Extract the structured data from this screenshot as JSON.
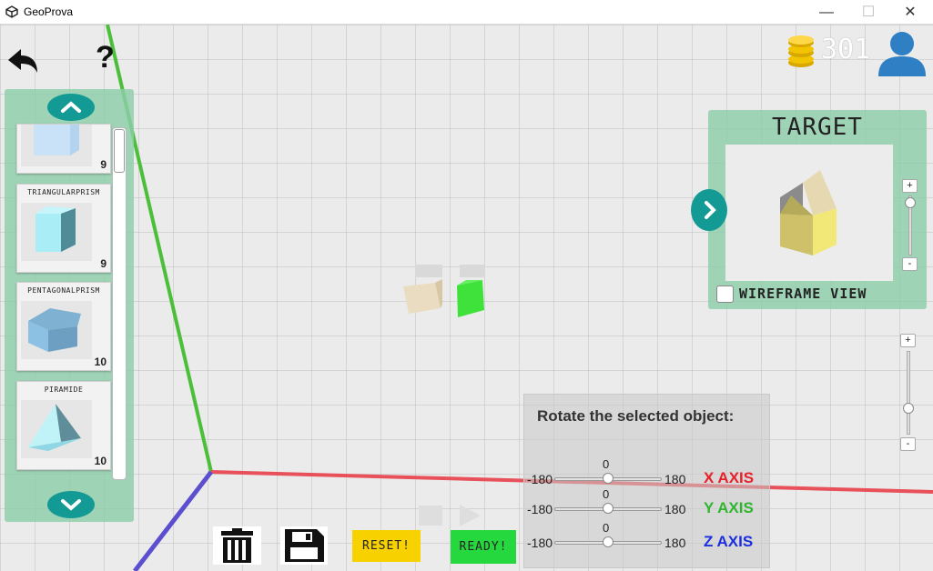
{
  "window": {
    "title": "GeoProva",
    "icon": "unity-icon",
    "minimize": "—",
    "maximize": "☐",
    "close": "✕"
  },
  "top_bar": {
    "back_icon": "back-arrow-icon",
    "help_label": "?",
    "coins": "301",
    "coin_icon": "coin-stack-icon",
    "profile_icon": "user-icon"
  },
  "shape_list": {
    "up_icon": "chevron-up-icon",
    "down_icon": "chevron-down-icon",
    "items": [
      {
        "name": "",
        "count": "9",
        "icon": "cube-icon"
      },
      {
        "name": "TRIANGULARPRISM",
        "count": "9",
        "icon": "triangular-prism-icon"
      },
      {
        "name": "PENTAGONALPRISM",
        "count": "10",
        "icon": "pentagonal-prism-icon"
      },
      {
        "name": "PIRAMIDE",
        "count": "10",
        "icon": "pyramid-icon"
      }
    ]
  },
  "target": {
    "title": "TARGET",
    "next_icon": "chevron-right-icon",
    "zoom_in": "+",
    "zoom_out": "-",
    "wireframe_label": "WIREFRAME VIEW",
    "wireframe_checked": false
  },
  "camera_zoom": {
    "zoom_in": "+",
    "zoom_out": "-"
  },
  "rotation": {
    "title": "Rotate the selected object:",
    "axes": [
      {
        "label": "X AXIS",
        "min": "-180",
        "max": "180",
        "value": "0",
        "color": "#e8202a"
      },
      {
        "label": "Y AXIS",
        "min": "-180",
        "max": "180",
        "value": "0",
        "color": "#2fb52f"
      },
      {
        "label": "Z AXIS",
        "min": "-180",
        "max": "180",
        "value": "0",
        "color": "#1c2ee0"
      }
    ]
  },
  "toolbar": {
    "delete_icon": "trash-icon",
    "save_icon": "floppy-disk-icon",
    "reset_label": "RESET!",
    "ready_label": "READY!"
  },
  "colors": {
    "panel": "#8ecdaa",
    "accent_teal": "#139a94",
    "reset_bg": "#f8d200",
    "ready_bg": "#25d83e",
    "axis_x": "#e8505a",
    "axis_y": "#4cbf3a",
    "axis_z": "#5b4fcf"
  }
}
